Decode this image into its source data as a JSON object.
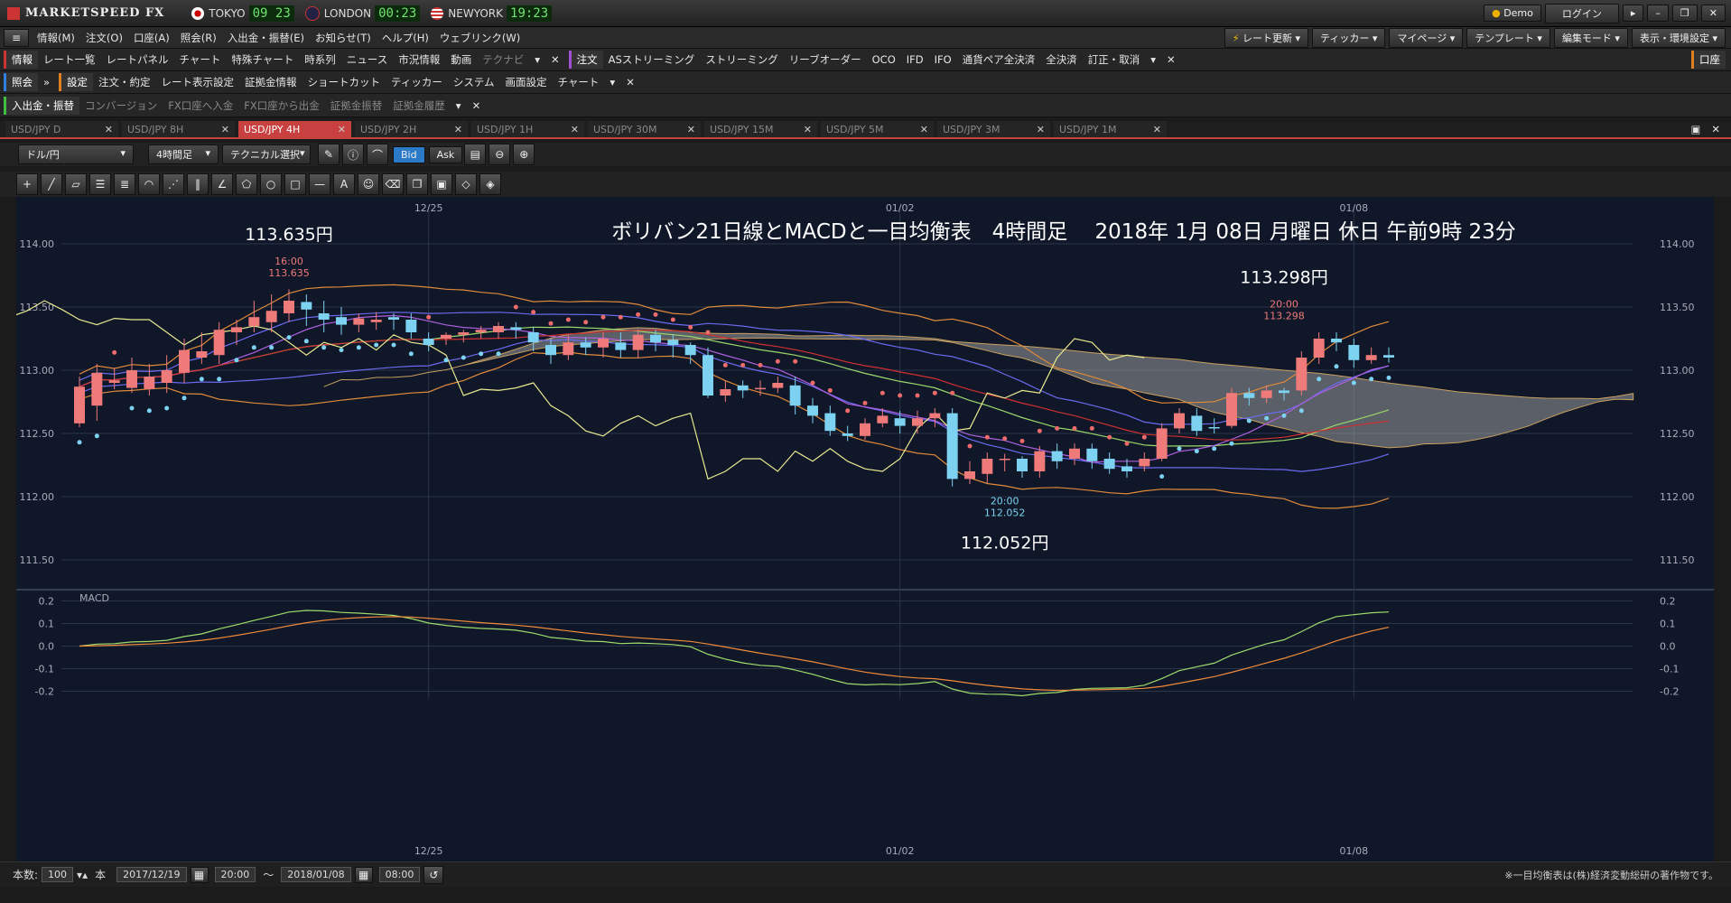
{
  "titlebar": {
    "app_name": "MARKETSPEED FX",
    "clocks": [
      {
        "city": "TOKYO",
        "time": "09 23"
      },
      {
        "city": "LONDON",
        "time": "00:23"
      },
      {
        "city": "NEWYORK",
        "time": "19:23"
      }
    ],
    "demo_label": "Demo",
    "login_label": "ログイン"
  },
  "menubar": {
    "items": [
      "情報(M)",
      "注文(O)",
      "口座(A)",
      "照会(R)",
      "入出金・振替(E)",
      "お知らせ(T)",
      "ヘルプ(H)",
      "ウェブリンク(W)"
    ],
    "right_items": [
      "レート更新",
      "ティッカー",
      "マイページ",
      "テンプレート",
      "編集モード",
      "表示・環境設定"
    ]
  },
  "toolbar1": {
    "section_info": "情報",
    "info_items": [
      "レート一覧",
      "レートパネル",
      "チャート",
      "特殊チャート",
      "時系列",
      "ニュース",
      "市況情報",
      "動画",
      "テクナビ"
    ],
    "section_order": "注文",
    "order_items": [
      "ASストリーミング",
      "ストリーミング",
      "リーブオーダー",
      "OCO",
      "IFD",
      "IFO",
      "通貨ペア全決済",
      "全決済",
      "訂正・取消"
    ],
    "account_label": "口座"
  },
  "toolbar2": {
    "section_query": "照会",
    "section_settings": "設定",
    "items": [
      "注文・約定",
      "レート表示設定",
      "証拠金情報",
      "ショートカット",
      "ティッカー",
      "システム",
      "画面設定",
      "チャート"
    ]
  },
  "toolbar3": {
    "section": "入出金・振替",
    "items": [
      "コンバージョン",
      "FX口座へ入金",
      "FX口座から出金",
      "証拠金振替",
      "証拠金履歴"
    ]
  },
  "tabs": [
    "USD/JPY D",
    "USD/JPY 8H",
    "USD/JPY 4H",
    "USD/JPY 2H",
    "USD/JPY 1H",
    "USD/JPY 30M",
    "USD/JPY 15M",
    "USD/JPY 5M",
    "USD/JPY 3M",
    "USD/JPY 1M"
  ],
  "active_tab": 2,
  "chart_toolbar": {
    "currency": "ドル/円",
    "interval": "4時間足",
    "technical": "テクニカル選択",
    "bid": "Bid",
    "ask": "Ask"
  },
  "statusbar": {
    "count_label": "本数:",
    "count_value": "100",
    "unit": "本",
    "from_date": "2017/12/19",
    "from_time": "20:00",
    "tilde": "〜",
    "to_date": "2018/01/08",
    "to_time": "08:00",
    "copyright": "※一目均衡表は(株)経済変動総研の著作物です。"
  },
  "chart_data": {
    "type": "candlestick",
    "title": "ボリバン21日線とMACDと一目均衡表　4時間足　 2018年 1月 08日 月曜日 休日 午前9時 23分",
    "x_labels": [
      "12/25",
      "01/02",
      "01/08"
    ],
    "x_label_index": [
      20,
      47,
      73
    ],
    "ylim": [
      111.3,
      114.3
    ],
    "yticks": [
      111.5,
      112.0,
      112.5,
      113.0,
      113.5,
      114.0
    ],
    "macd_ylim": [
      -0.23,
      0.23
    ],
    "macd_yticks": [
      0.2,
      0.1,
      0.0,
      -0.1,
      -0.2
    ],
    "macd_label": "MACD",
    "grid": true,
    "colors": {
      "up": "#ef7a7a",
      "down": "#7cd2f0",
      "background": "#0f1729",
      "cloud": "#9a9a9a",
      "macd": "#9edc6c",
      "signal": "#ef8a3a",
      "sar_up": "#7cd2f0",
      "sar_down": "#ef6a6a"
    },
    "annotations": [
      {
        "text": "113.635円",
        "index": 12,
        "value": 113.635,
        "time": "16:00",
        "price": "113.635"
      },
      {
        "text": "113.298円",
        "index": 69,
        "value": 113.298,
        "time": "20:00",
        "price": "113.298"
      },
      {
        "text": "112.052円",
        "index": 53,
        "value": 112.052,
        "time": "20:00",
        "price": "112.052"
      }
    ],
    "candles": [
      [
        112.58,
        112.87,
        112.55,
        112.95
      ],
      [
        112.72,
        112.98,
        112.6,
        113.05
      ],
      [
        112.9,
        112.92,
        112.85,
        113.02
      ],
      [
        112.86,
        113.0,
        112.82,
        113.1
      ],
      [
        112.85,
        112.95,
        112.8,
        113.05
      ],
      [
        112.9,
        113.0,
        112.82,
        113.12
      ],
      [
        112.98,
        113.16,
        112.9,
        113.25
      ],
      [
        113.1,
        113.15,
        113.05,
        113.3
      ],
      [
        113.12,
        113.32,
        113.05,
        113.38
      ],
      [
        113.3,
        113.34,
        113.2,
        113.4
      ],
      [
        113.35,
        113.42,
        113.3,
        113.55
      ],
      [
        113.38,
        113.47,
        113.3,
        113.6
      ],
      [
        113.45,
        113.55,
        113.38,
        113.64
      ],
      [
        113.54,
        113.48,
        113.35,
        113.6
      ],
      [
        113.45,
        113.4,
        113.3,
        113.55
      ],
      [
        113.42,
        113.36,
        113.28,
        113.5
      ],
      [
        113.36,
        113.41,
        113.3,
        113.45
      ],
      [
        113.38,
        113.4,
        113.32,
        113.46
      ],
      [
        113.42,
        113.4,
        113.32,
        113.45
      ],
      [
        113.4,
        113.3,
        113.25,
        113.45
      ],
      [
        113.25,
        113.2,
        113.15,
        113.3
      ],
      [
        113.25,
        113.28,
        113.2,
        113.3
      ],
      [
        113.28,
        113.3,
        113.22,
        113.32
      ],
      [
        113.3,
        113.32,
        113.25,
        113.35
      ],
      [
        113.3,
        113.35,
        113.25,
        113.38
      ],
      [
        113.34,
        113.32,
        113.25,
        113.38
      ],
      [
        113.3,
        113.22,
        113.15,
        113.34
      ],
      [
        113.2,
        113.12,
        113.05,
        113.25
      ],
      [
        113.12,
        113.22,
        113.08,
        113.28
      ],
      [
        113.22,
        113.18,
        113.12,
        113.26
      ],
      [
        113.18,
        113.25,
        113.1,
        113.3
      ],
      [
        113.22,
        113.16,
        113.1,
        113.3
      ],
      [
        113.16,
        113.28,
        113.1,
        113.32
      ],
      [
        113.28,
        113.22,
        113.15,
        113.32
      ],
      [
        113.24,
        113.2,
        113.1,
        113.28
      ],
      [
        113.2,
        113.12,
        113.05,
        113.22
      ],
      [
        113.12,
        112.8,
        112.78,
        113.18
      ],
      [
        112.8,
        112.85,
        112.75,
        112.92
      ],
      [
        112.88,
        112.84,
        112.78,
        112.92
      ],
      [
        112.85,
        112.86,
        112.8,
        112.92
      ],
      [
        112.86,
        112.9,
        112.82,
        112.95
      ],
      [
        112.88,
        112.72,
        112.65,
        112.95
      ],
      [
        112.72,
        112.64,
        112.58,
        112.78
      ],
      [
        112.66,
        112.52,
        112.48,
        112.72
      ],
      [
        112.5,
        112.48,
        112.44,
        112.56
      ],
      [
        112.48,
        112.58,
        112.45,
        112.62
      ],
      [
        112.58,
        112.64,
        112.55,
        112.7
      ],
      [
        112.62,
        112.56,
        112.5,
        112.68
      ],
      [
        112.56,
        112.62,
        112.5,
        112.68
      ],
      [
        112.62,
        112.66,
        112.55,
        112.7
      ],
      [
        112.66,
        112.14,
        112.08,
        112.7
      ],
      [
        112.14,
        112.2,
        112.1,
        112.28
      ],
      [
        112.18,
        112.3,
        112.1,
        112.35
      ],
      [
        112.3,
        112.3,
        112.2,
        112.34
      ],
      [
        112.3,
        112.2,
        112.15,
        112.32
      ],
      [
        112.2,
        112.36,
        112.15,
        112.4
      ],
      [
        112.36,
        112.28,
        112.22,
        112.42
      ],
      [
        112.3,
        112.38,
        112.25,
        112.42
      ],
      [
        112.38,
        112.28,
        112.22,
        112.42
      ],
      [
        112.3,
        112.22,
        112.18,
        112.35
      ],
      [
        112.24,
        112.2,
        112.15,
        112.3
      ],
      [
        112.24,
        112.3,
        112.2,
        112.35
      ],
      [
        112.3,
        112.54,
        112.28,
        112.58
      ],
      [
        112.54,
        112.66,
        112.5,
        112.7
      ],
      [
        112.64,
        112.52,
        112.48,
        112.7
      ],
      [
        112.55,
        112.54,
        112.5,
        112.62
      ],
      [
        112.56,
        112.82,
        112.54,
        112.86
      ],
      [
        112.82,
        112.78,
        112.72,
        112.86
      ],
      [
        112.78,
        112.84,
        112.74,
        112.88
      ],
      [
        112.84,
        112.82,
        112.76,
        112.86
      ],
      [
        112.84,
        113.1,
        112.8,
        113.15
      ],
      [
        113.1,
        113.25,
        113.05,
        113.3
      ],
      [
        113.25,
        113.22,
        113.15,
        113.3
      ],
      [
        113.2,
        113.08,
        113.02,
        113.25
      ],
      [
        113.08,
        113.12,
        113.05,
        113.18
      ],
      [
        113.12,
        113.1,
        113.06,
        113.18
      ]
    ]
  }
}
